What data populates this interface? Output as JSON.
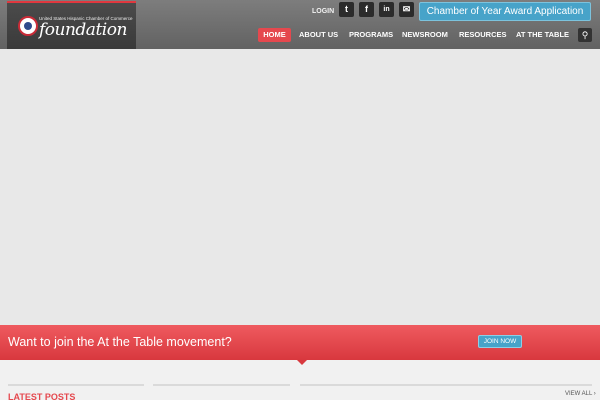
{
  "logo": {
    "tagline": "United States Hispanic Chamber of Commerce",
    "wordmark": "foundation"
  },
  "topbar": {
    "login": "LOGIN",
    "social": [
      {
        "icon": "twitter-icon",
        "glyph": "t"
      },
      {
        "icon": "facebook-icon",
        "glyph": "f"
      },
      {
        "icon": "linkedin-icon",
        "glyph": "in"
      },
      {
        "icon": "email-icon",
        "glyph": "✉"
      }
    ],
    "award_button": "Chamber of Year Award Application"
  },
  "nav": {
    "items": [
      "HOME",
      "ABOUT US",
      "PROGRAMS",
      "NEWSROOM",
      "RESOURCES",
      "AT THE TABLE"
    ],
    "active": "HOME",
    "search_icon": "⚲"
  },
  "cta": {
    "text": "Want to join the At the Table movement?",
    "button": "JOIN NOW"
  },
  "posts": {
    "heading": "LATEST POSTS",
    "view_all": "VIEW ALL ›"
  },
  "colors": {
    "accent_red": "#e5484e",
    "accent_blue": "#47a3c9",
    "header_gray": "#6e6e6e"
  }
}
